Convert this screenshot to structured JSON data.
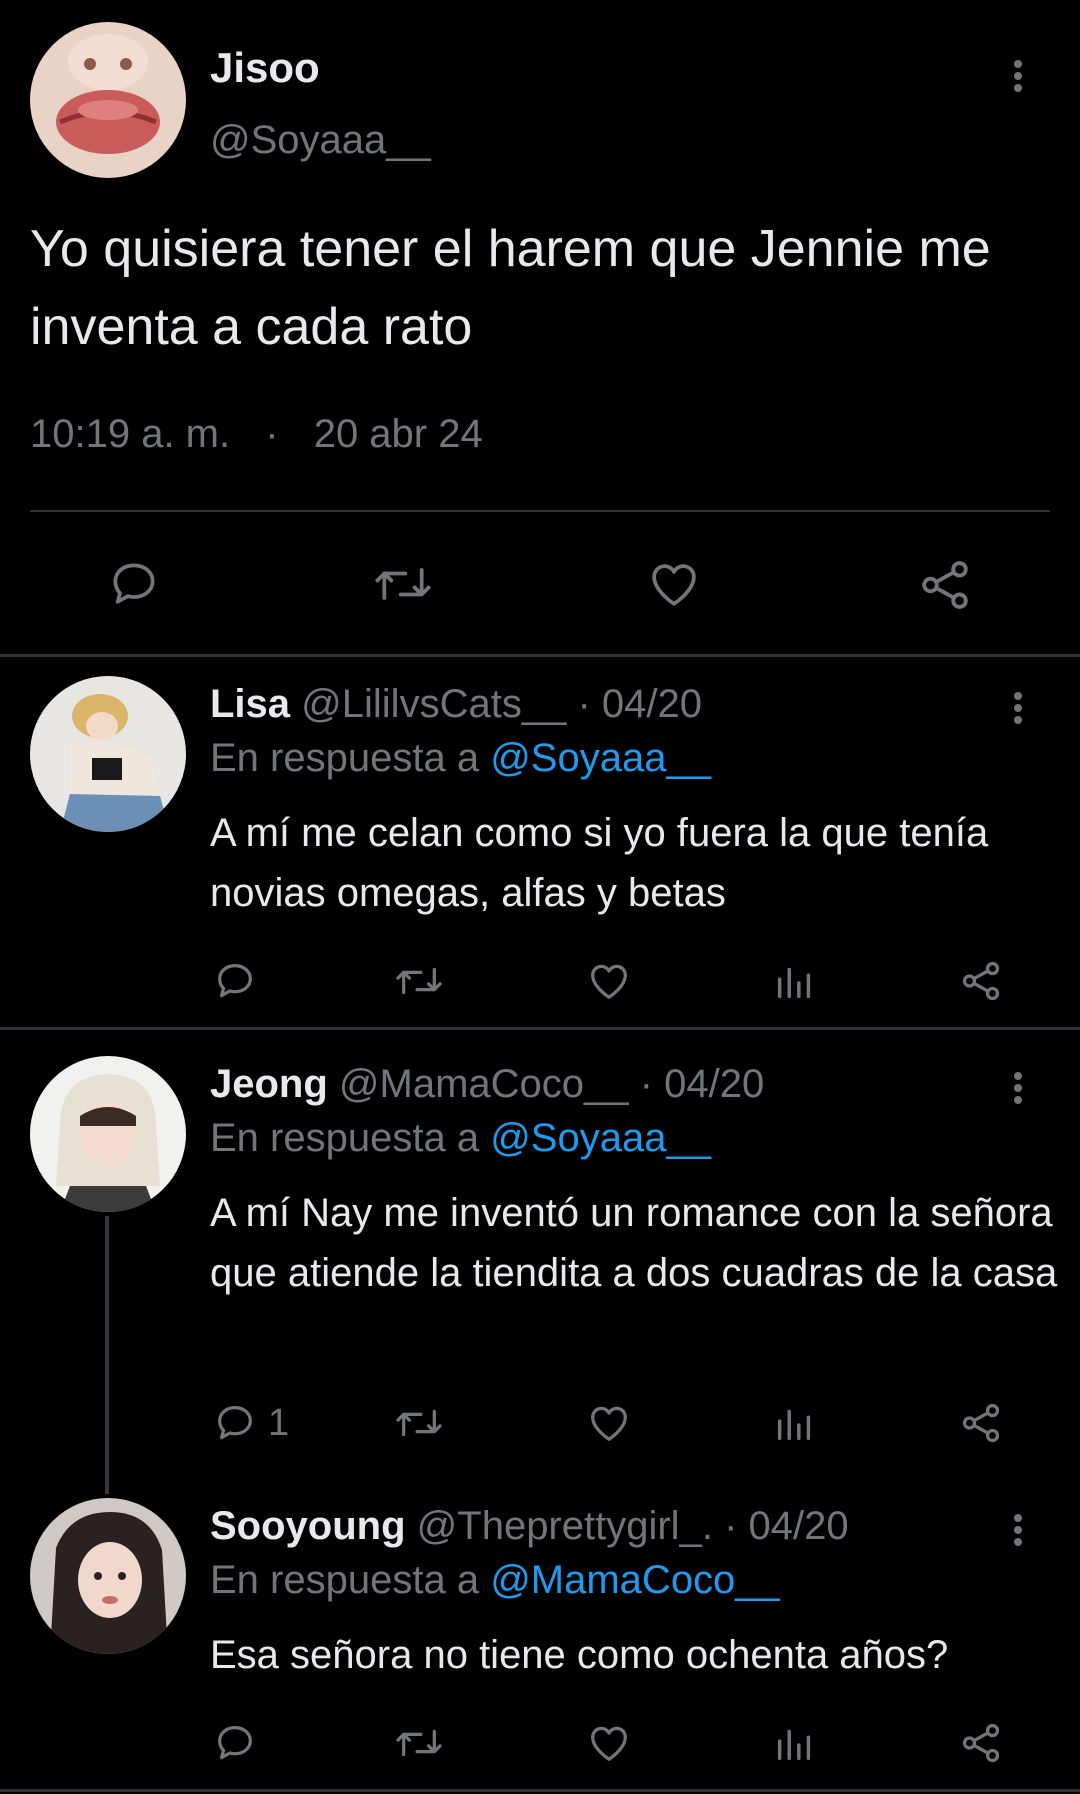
{
  "main_tweet": {
    "display_name": "Jisoo",
    "handle": "@Soyaaa__",
    "text": "Yo quisiera tener el harem que Jennie me inventa a cada rato",
    "time": "10:19 a. m.",
    "separator": "·",
    "date": "20 abr 24"
  },
  "replies": [
    {
      "display_name": "Lisa",
      "handle": "@LililvsCats__",
      "date": "· 04/20",
      "reply_prefix": "En respuesta a",
      "reply_to": "@Soyaaa__",
      "text": "A mí me celan como si yo fuera la que tenía novias omegas, alfas y betas",
      "reply_count": ""
    },
    {
      "display_name": "Jeong",
      "handle": "@MamaCoco__",
      "date": "· 04/20",
      "reply_prefix": "En respuesta a",
      "reply_to": "@Soyaaa__",
      "text": "A mí Nay me inventó un romance con la señora que atiende la tiendita a dos cuadras de la casa",
      "reply_count": "1"
    },
    {
      "display_name": "Sooyoung",
      "handle": "@Theprettygirl_.",
      "date": "· 04/20",
      "reply_prefix": "En respuesta a",
      "reply_to": "@MamaCoco__",
      "text": "Esa señora no tiene como ochenta años?",
      "reply_count": ""
    }
  ],
  "colors": {
    "background": "#000000",
    "text": "#e7e9ea",
    "muted": "#71767b",
    "link": "#1d9bf0",
    "divider": "#2f3336"
  },
  "icons": [
    "reply-icon",
    "retweet-icon",
    "like-icon",
    "views-icon",
    "share-icon",
    "more-icon"
  ]
}
